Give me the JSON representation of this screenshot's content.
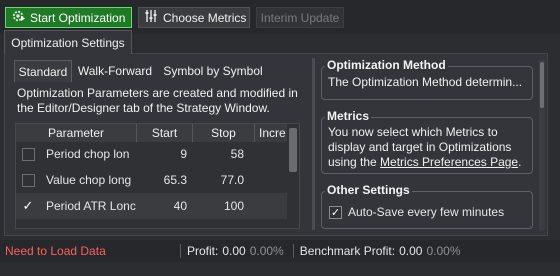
{
  "toolbar": {
    "start_label": "Start Optimization",
    "metrics_label": "Choose Metrics",
    "interim_label": "Interim Update"
  },
  "outer_tab": {
    "label": "Optimization Settings"
  },
  "inner_tabs": [
    {
      "label": "Standard"
    },
    {
      "label": "Walk-Forward"
    },
    {
      "label": "Symbol by Symbol"
    }
  ],
  "description": "Optimization Parameters are created and modified in the Editor/Designer tab of the Strategy Window.",
  "grid": {
    "columns": [
      "Parameter",
      "Start",
      "Stop",
      "Incre"
    ],
    "rows": [
      {
        "name": "Period chop lon",
        "start": "9",
        "stop": "58",
        "checked": false
      },
      {
        "name": "Value chop long",
        "start": "65.3",
        "stop": "77.0",
        "checked": false
      },
      {
        "name": "Period ATR Lonc",
        "start": "40",
        "stop": "100",
        "checked": true
      }
    ]
  },
  "panels": {
    "method": {
      "title": "Optimization Method",
      "text": "The Optimization Method determin..."
    },
    "metrics": {
      "title": "Metrics",
      "text_line1": "You now select which Metrics to",
      "text_line2": "display and target in Optimizations",
      "text_prefix": "using the ",
      "link": "Metrics Preferences Page",
      "text_suffix": "."
    },
    "other": {
      "title": "Other Settings",
      "autosave": "Auto-Save every few minutes",
      "autosave_checked": true
    }
  },
  "status": {
    "warning": "Need to Load Data",
    "profit_label": "Profit:",
    "profit_value": "0.00",
    "profit_pct": "0.00%",
    "bench_label": "Benchmark Profit:",
    "bench_value": "0.00",
    "bench_pct": "0.00%"
  },
  "icons": {
    "start": "gear-play-icon",
    "metrics": "sliders-icon",
    "check": "checkmark-icon"
  },
  "colors": {
    "start_bg": "#1f7a27",
    "start_border": "#6ad86a",
    "warning": "#ff5f5f"
  }
}
